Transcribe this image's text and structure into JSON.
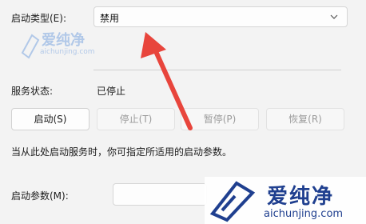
{
  "startup_type": {
    "label": "启动类型(E):",
    "selected": "禁用"
  },
  "service_status": {
    "label": "服务状态:",
    "value": "已停止"
  },
  "buttons": {
    "start": "启动(S)",
    "stop": "停止(T)",
    "pause": "暂停(P)",
    "resume": "恢复(R)"
  },
  "hint_text": "当从此处启动服务时，你可指定所适用的启动参数。",
  "start_params": {
    "label": "启动参数(M):",
    "value": ""
  },
  "watermark": {
    "brand": "爱纯净",
    "url": "aichunjing.com"
  },
  "colors": {
    "arrow": "#e8453c",
    "watermark": "#1f3f8f"
  }
}
